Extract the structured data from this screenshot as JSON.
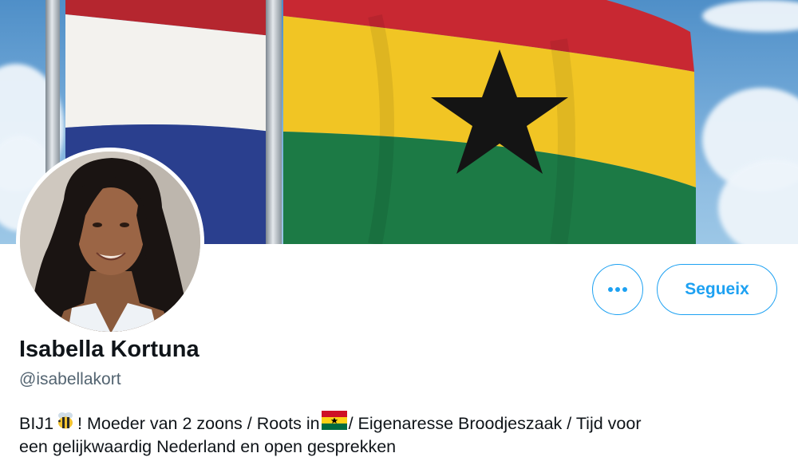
{
  "profile": {
    "name": "Isabella Kortuna",
    "handle": "@isabellakort",
    "bio": {
      "part1": "BIJ1",
      "part2": "! Moeder van 2 zoons / Roots in ",
      "part3": "/ Eigenaresse Broodjeszaak / Tijd voor",
      "line2": "een gelijkwaardig Nederland en open gesprekken"
    }
  },
  "actions": {
    "more_label": "•••",
    "follow_label": "Segueix"
  },
  "icons": {
    "bio_emoji_1": "bee-icon",
    "bio_emoji_2": "ghana-flag-icon",
    "more": "more-options-icon"
  },
  "colors": {
    "accent": "#1da1f2",
    "handle": "#536471",
    "text": "#0f1419"
  }
}
